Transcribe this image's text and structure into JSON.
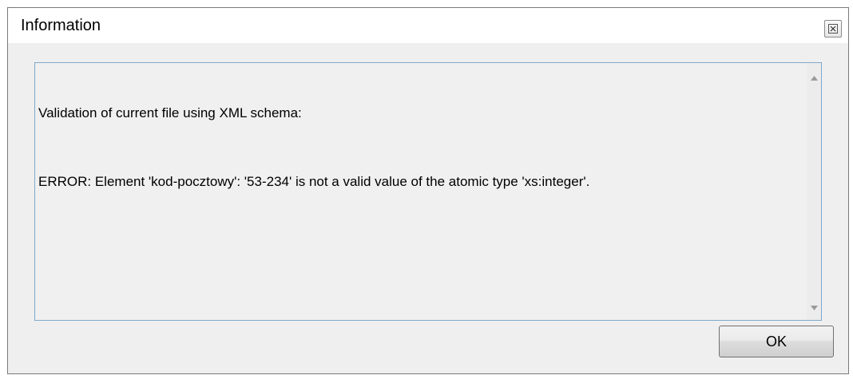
{
  "window": {
    "title": "Information",
    "close_icon": "close-icon"
  },
  "message": {
    "line1": "Validation of current file using XML schema:",
    "line2": "ERROR: Element 'kod-pocztowy': '53-234' is not a valid value of the atomic type 'xs:integer'."
  },
  "scrollbar": {
    "up_icon": "scroll-up-arrow-icon",
    "down_icon": "scroll-down-arrow-icon"
  },
  "buttons": {
    "ok_label": "OK"
  },
  "colors": {
    "content_border": "#7fa9cc",
    "dialog_background": "#efefef"
  }
}
